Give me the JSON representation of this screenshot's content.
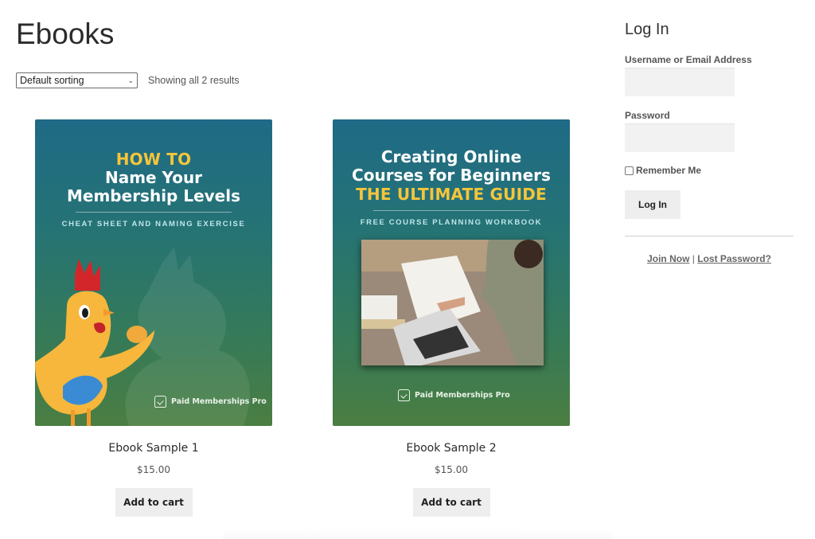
{
  "page": {
    "title": "Ebooks"
  },
  "toolbar": {
    "sort_selected": "Default sorting",
    "result_count": "Showing all 2 results"
  },
  "products": [
    {
      "name": "Ebook Sample 1",
      "price": "$15.00",
      "button_label": "Add to cart",
      "cover": {
        "kicker": "HOW TO",
        "headline_lines": [
          "Name Your",
          "Membership Levels"
        ],
        "subline": "CHEAT SHEET AND NAMING EXERCISE",
        "brand": "Paid Memberships Pro",
        "illustration": "rooster-holding-egg"
      }
    },
    {
      "name": "Ebook Sample 2",
      "price": "$15.00",
      "button_label": "Add to cart",
      "cover": {
        "headline_lines": [
          "Creating Online",
          "Courses for Beginners"
        ],
        "kicker": "THE ULTIMATE GUIDE",
        "subline": "FREE COURSE PLANNING WORKBOOK",
        "brand": "Paid Memberships Pro",
        "illustration": "woman-writing-at-laptop-photo"
      }
    }
  ],
  "login": {
    "title": "Log In",
    "username_label": "Username or Email Address",
    "username_value": "",
    "password_label": "Password",
    "password_value": "",
    "remember_label": "Remember Me",
    "remember_checked": false,
    "submit_label": "Log In",
    "join_link": "Join Now",
    "separator": "|",
    "lost_password_link": "Lost Password?"
  },
  "colors": {
    "cover_top": "#1f6a86",
    "cover_bottom": "#4b7e42",
    "cover_accent_yellow": "#f5c53a",
    "button_bg": "#eeeeee",
    "input_bg": "#f2f2f2"
  }
}
